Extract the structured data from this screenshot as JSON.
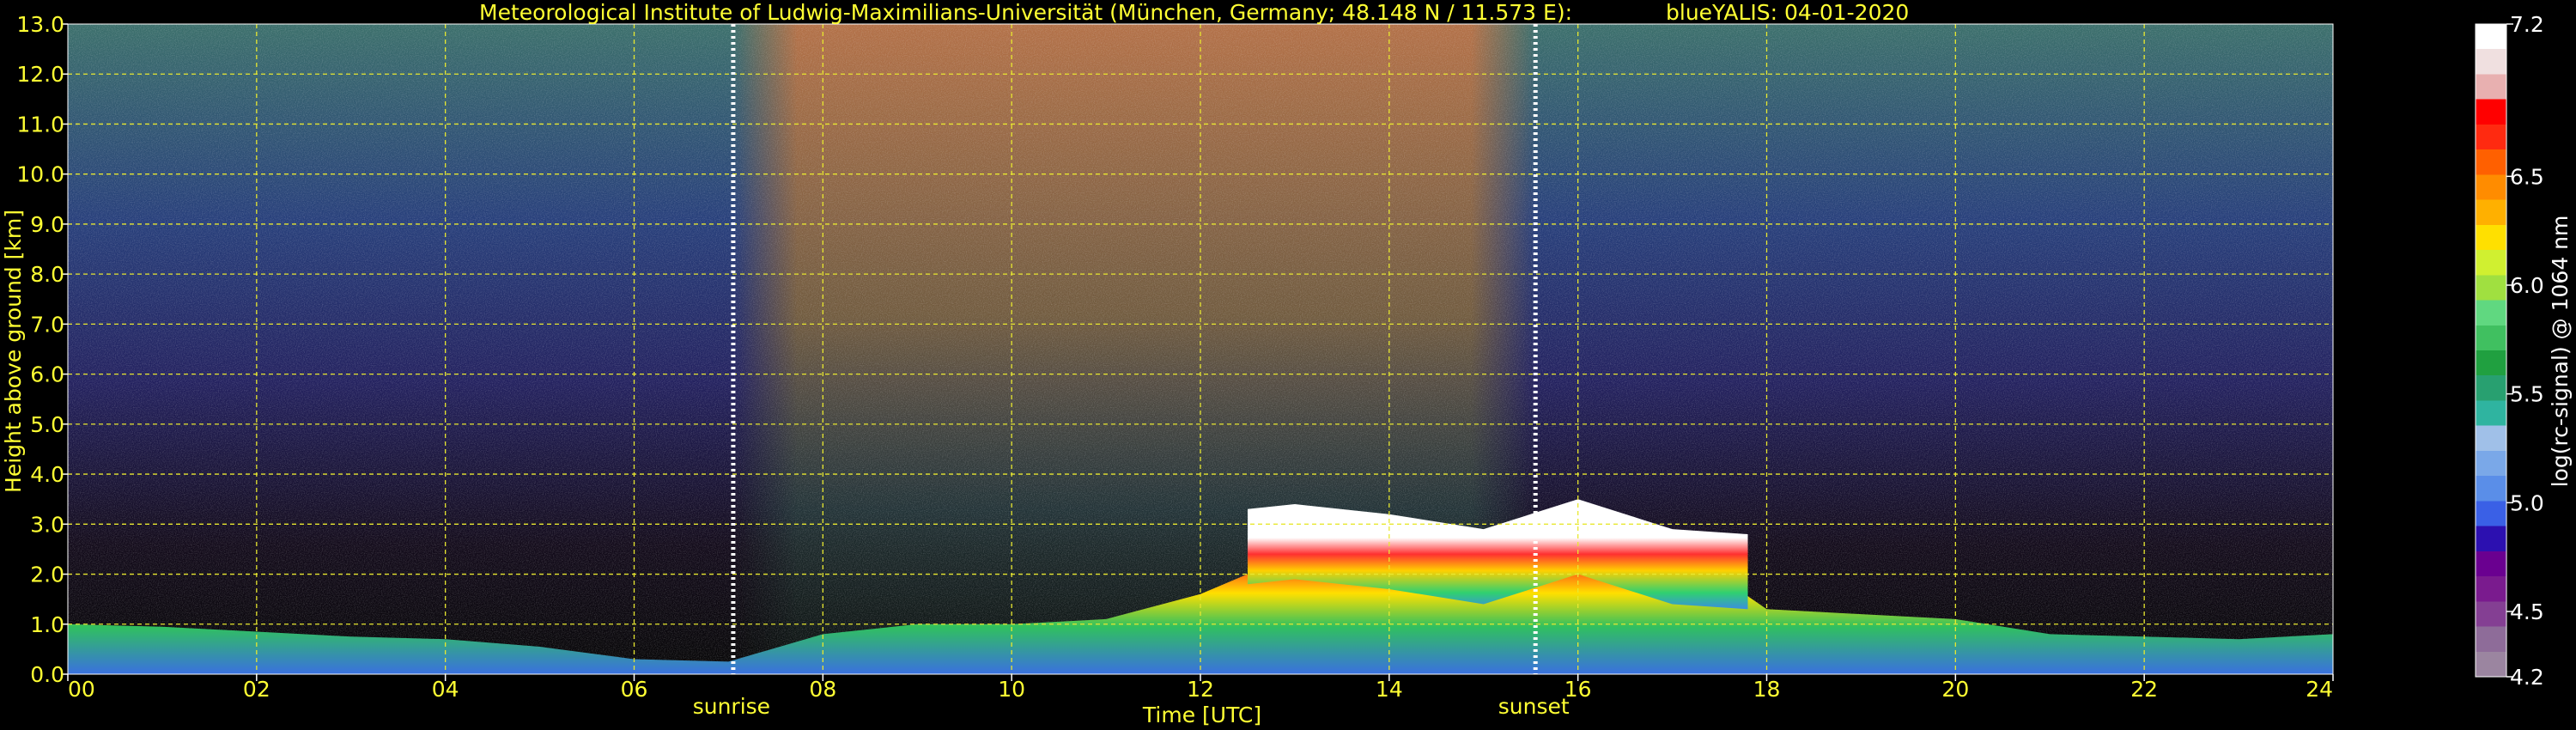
{
  "chart_data": {
    "type": "heatmap",
    "title": "Meteorological Institute of Ludwig-Maximilians-Universität (München, Germany; 48.148 N / 11.573 E):",
    "instrument_date": "blueYALIS: 04-01-2020",
    "xlabel": "Time [UTC]",
    "ylabel": "Height above ground [km]",
    "xlim": [
      0,
      24
    ],
    "ylim": [
      0,
      13
    ],
    "x_ticks": [
      "00",
      "02",
      "04",
      "06",
      "08",
      "10",
      "12",
      "14",
      "16",
      "18",
      "20",
      "22",
      "24"
    ],
    "y_ticks": [
      "0.0",
      "1.0",
      "2.0",
      "3.0",
      "4.0",
      "5.0",
      "6.0",
      "7.0",
      "8.0",
      "9.0",
      "10.0",
      "11.0",
      "12.0",
      "13.0"
    ],
    "grid": true,
    "sunrise": {
      "time": 7.05,
      "label": "sunrise"
    },
    "sunset": {
      "time": 15.55,
      "label": "sunset"
    },
    "colorbar": {
      "label": "log(rc-signal) @ 1064 nm",
      "range": [
        4.2,
        7.2
      ],
      "ticks": [
        "4.2",
        "4.5",
        "5.0",
        "5.5",
        "6.0",
        "6.5",
        "7.2"
      ],
      "colors": [
        "#9b85a0",
        "#8e6c99",
        "#843f93",
        "#7a1b8e",
        "#6a0090",
        "#2c10b0",
        "#3a60e6",
        "#5a8ee8",
        "#7aa8e8",
        "#a0c0e8",
        "#2fb4a0",
        "#28a070",
        "#20a040",
        "#40c060",
        "#60d880",
        "#a0e040",
        "#d0f030",
        "#ffe000",
        "#ffb000",
        "#ff8c00",
        "#ff6000",
        "#ff2a10",
        "#ff0000",
        "#e8b0b0",
        "#f0e0e0",
        "#ffffff"
      ]
    },
    "layers": {
      "boundary_layer_top_km": [
        [
          0,
          1.0
        ],
        [
          1,
          0.95
        ],
        [
          2,
          0.85
        ],
        [
          3,
          0.75
        ],
        [
          4,
          0.7
        ],
        [
          5,
          0.55
        ],
        [
          6,
          0.3
        ],
        [
          7,
          0.25
        ],
        [
          8,
          0.8
        ],
        [
          9,
          1.0
        ],
        [
          10,
          1.0
        ],
        [
          11,
          1.1
        ],
        [
          12,
          1.6
        ],
        [
          13,
          2.4
        ],
        [
          14,
          2.6
        ],
        [
          15,
          2.7
        ],
        [
          16,
          2.7
        ],
        [
          17,
          2.6
        ],
        [
          18,
          1.3
        ],
        [
          19,
          1.2
        ],
        [
          20,
          1.1
        ],
        [
          21,
          0.8
        ],
        [
          22,
          0.75
        ],
        [
          23,
          0.7
        ],
        [
          24,
          0.8
        ]
      ],
      "cloud_top_km": [
        [
          12.5,
          3.3
        ],
        [
          13,
          3.4
        ],
        [
          14,
          3.2
        ],
        [
          15,
          2.9
        ],
        [
          16,
          3.5
        ],
        [
          17,
          2.9
        ],
        [
          17.8,
          2.8
        ]
      ]
    }
  }
}
